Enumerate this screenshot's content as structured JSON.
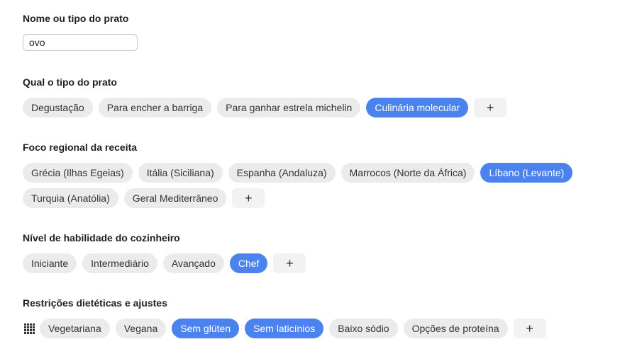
{
  "name_section": {
    "title": "Nome ou tipo do prato",
    "input_value": "ovo"
  },
  "type_section": {
    "title": "Qual o tipo do prato",
    "options": [
      {
        "label": "Degustação",
        "selected": false
      },
      {
        "label": "Para encher a barriga",
        "selected": false
      },
      {
        "label": "Para ganhar estrela michelin",
        "selected": false
      },
      {
        "label": "Culinária molecular",
        "selected": true
      }
    ],
    "add_label": "+"
  },
  "region_section": {
    "title": "Foco regional da receita",
    "options": [
      {
        "label": "Grécia (Ilhas Egeias)",
        "selected": false
      },
      {
        "label": "Itália (Siciliana)",
        "selected": false
      },
      {
        "label": "Espanha (Andaluza)",
        "selected": false
      },
      {
        "label": "Marrocos (Norte da África)",
        "selected": false
      },
      {
        "label": "Líbano (Levante)",
        "selected": true
      },
      {
        "label": "Turquia (Anatólia)",
        "selected": false
      },
      {
        "label": "Geral Mediterrâneo",
        "selected": false
      }
    ],
    "add_label": "+"
  },
  "skill_section": {
    "title": "Nível de habilidade do cozinheiro",
    "options": [
      {
        "label": "Iniciante",
        "selected": false
      },
      {
        "label": "Intermediário",
        "selected": false
      },
      {
        "label": "Avançado",
        "selected": false
      },
      {
        "label": "Chef",
        "selected": true
      }
    ],
    "add_label": "+"
  },
  "diet_section": {
    "title": "Restrições dietéticas e ajustes",
    "handle_icon": "grid-icon",
    "options": [
      {
        "label": "Vegetariana",
        "selected": false
      },
      {
        "label": "Vegana",
        "selected": false
      },
      {
        "label": "Sem glúten",
        "selected": true
      },
      {
        "label": "Sem laticínios",
        "selected": true
      },
      {
        "label": "Baixo sódio",
        "selected": false
      },
      {
        "label": "Opções de proteína",
        "selected": false
      }
    ],
    "add_label": "+"
  },
  "colors": {
    "selected_chip": "#4a82ee",
    "chip": "#ebebeb",
    "add_button": "#f2f2f2"
  }
}
